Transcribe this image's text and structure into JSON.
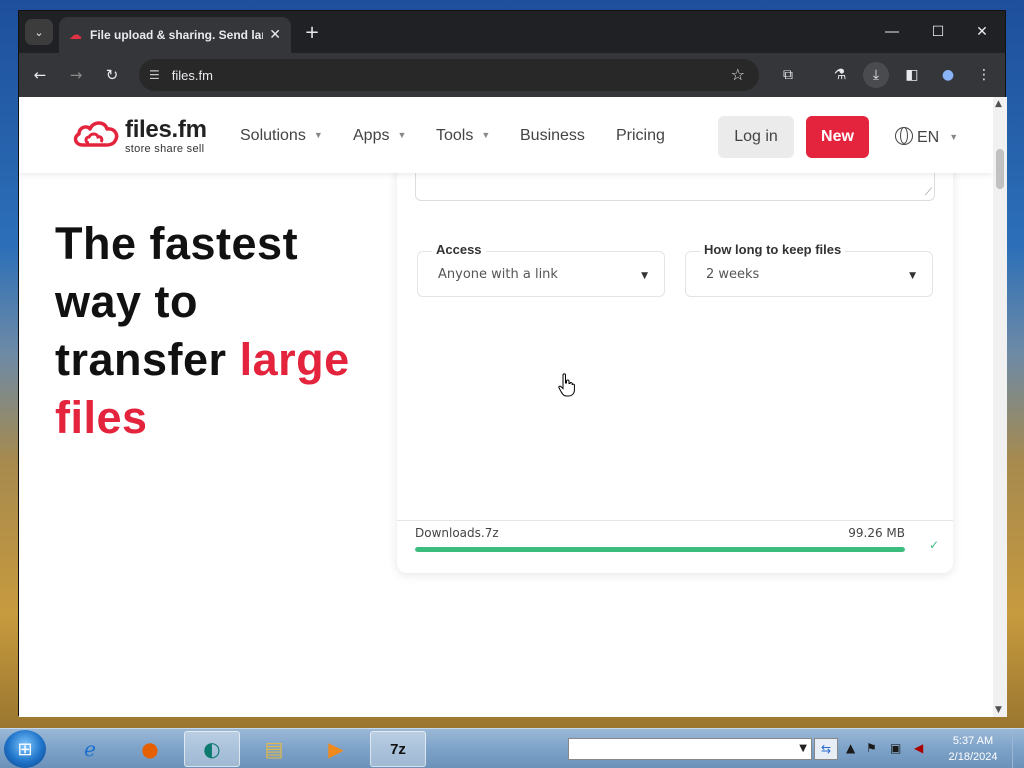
{
  "browser": {
    "tab_title": "File upload & sharing. Send lar",
    "url": "files.fm",
    "new_tab_symbol": "+",
    "tab_close_symbol": "✕"
  },
  "site": {
    "logo_name": "files.fm",
    "logo_tagline": "store share sell",
    "nav": {
      "solutions": "Solutions",
      "apps": "Apps",
      "tools": "Tools",
      "business": "Business",
      "pricing": "Pricing"
    },
    "login_label": "Log in",
    "new_label": "New",
    "language": "EN",
    "accent_color": "#e4233d"
  },
  "hero": {
    "line1": "The fastest",
    "line2": "way to",
    "line3_plain": "transfer",
    "line3_accent": "large",
    "line4_accent": "files"
  },
  "upload": {
    "access_label": "Access",
    "access_value": "Anyone with a link",
    "keep_label": "How long to keep files",
    "keep_value": "2 weeks",
    "file_name": "Downloads.7z",
    "file_size": "99.26 MB",
    "progress_percent": 100,
    "progress_color": "#3dbd7d"
  },
  "taskbar": {
    "time": "5:37 AM",
    "date": "2/18/2024",
    "pinned": [
      "internet-explorer",
      "firefox",
      "edge",
      "file-explorer",
      "media-player",
      "7zip"
    ]
  }
}
